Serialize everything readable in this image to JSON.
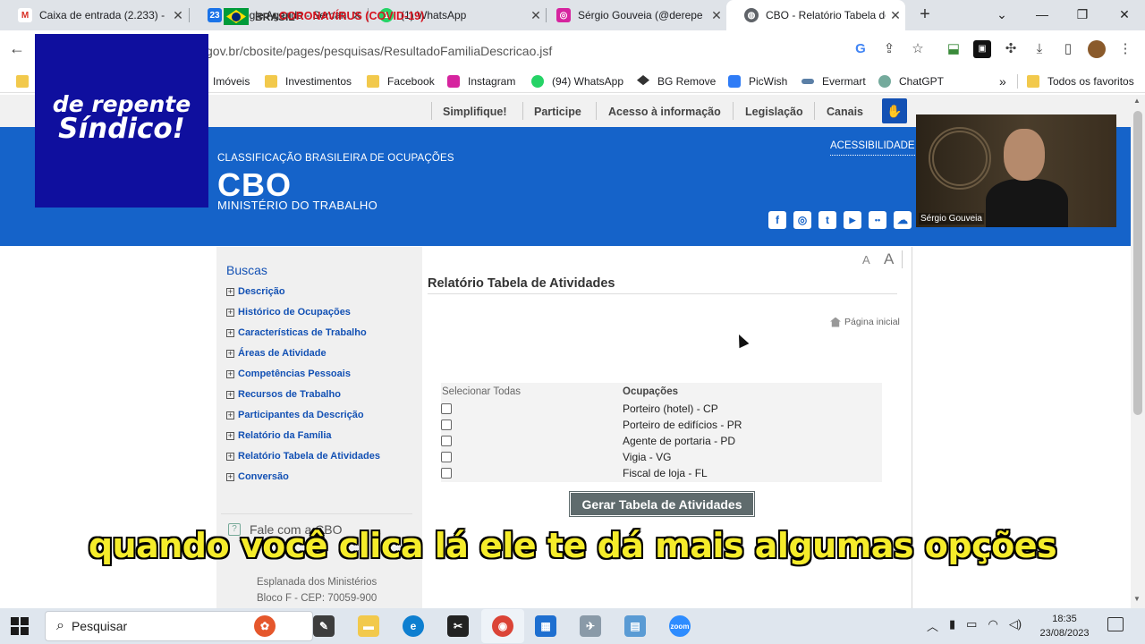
{
  "browser": {
    "tabs": [
      {
        "title": "Caixa de entrada (2.233) -",
        "icon": "gmail-icon",
        "color": "#d93025",
        "glyph": "M"
      },
      {
        "title": "Google Agenda - Semana",
        "icon": "calendar-icon",
        "color": "#1a73e8",
        "glyph": "23"
      },
      {
        "title": "(1) WhatsApp",
        "icon": "whatsapp-icon",
        "color": "#25d366",
        "glyph": "1"
      },
      {
        "title": "Sérgio Gouveia (@derepe",
        "icon": "instagram-icon",
        "color": "#d6249f",
        "glyph": "◎"
      },
      {
        "title": "CBO - Relatório Tabela de",
        "icon": "globe-icon",
        "color": "#5f6368",
        "glyph": "◍"
      }
    ],
    "url": "gov.br/cbosite/pages/pesquisas/ResultadoFamiliaDescricao.jsf",
    "bookmarks": [
      {
        "label": "Imóveis",
        "type": "folder"
      },
      {
        "label": "Investimentos",
        "type": "folder"
      },
      {
        "label": "Facebook",
        "type": "folder"
      },
      {
        "label": "Instagram",
        "type": "site",
        "color": "#d6249f"
      },
      {
        "label": "(94) WhatsApp",
        "type": "site",
        "color": "#25d366"
      },
      {
        "label": "BG Remove",
        "type": "site",
        "color": "#333333"
      },
      {
        "label": "PicWish",
        "type": "site",
        "color": "#2f7cf6"
      },
      {
        "label": "Evermart",
        "type": "site",
        "color": "#5b7fa6"
      },
      {
        "label": "ChatGPT",
        "type": "site",
        "color": "#74aa9c"
      }
    ],
    "more_bookmarks": "»",
    "all_favorites": "Todos os favoritos"
  },
  "overlay_logo": {
    "line1": "de repente",
    "line2": "Síndico!"
  },
  "webcam": {
    "name": "Sérgio Gouveia"
  },
  "govbar": {
    "brasil": "BRASIL",
    "covid": "CORONAVÍRUS (COVID-19)",
    "links": [
      "Simplifique!",
      "Participe",
      "Acesso à informação",
      "Legislação",
      "Canais"
    ]
  },
  "header": {
    "subtitle": "CLASSIFICAÇÃO BRASILEIRA DE OCUPAÇÕES",
    "title": "CBO",
    "ministry": "MINISTÉRIO DO TRABALHO",
    "accessibility": "ACESSIBILIDADE",
    "social": [
      {
        "name": "facebook-icon",
        "glyph": "f"
      },
      {
        "name": "instagram-icon",
        "glyph": "◎"
      },
      {
        "name": "twitter-icon",
        "glyph": "t"
      },
      {
        "name": "youtube-icon",
        "glyph": "▶"
      },
      {
        "name": "flickr-icon",
        "glyph": "••"
      },
      {
        "name": "soundcloud-icon",
        "glyph": "☁"
      }
    ]
  },
  "sidebar": {
    "title": "Buscas",
    "items": [
      "Descrição",
      "Histórico de Ocupações",
      "Características de Trabalho",
      "Áreas de Atividade",
      "Competências Pessoais",
      "Recursos de Trabalho",
      "Participantes da Descrição",
      "Relatório da Família",
      "Relatório Tabela de Atividades",
      "Conversão"
    ],
    "fale": "Fale com a CBO",
    "address1": "Esplanada dos Ministérios",
    "address2": "Bloco F - CEP: 70059-900"
  },
  "main": {
    "font_small": "A",
    "font_large": "A",
    "title": "Relatório Tabela de Atividades",
    "home_link": "Página inicial",
    "select_all": "Selecionar Todas",
    "occupations_header": "Ocupações",
    "occupations": [
      "Porteiro (hotel) - CP",
      "Porteiro de edifícios - PR",
      "Agente de portaria - PD",
      "Vigia - VG",
      "Fiscal de loja - FL"
    ],
    "generate_button": "Gerar Tabela de Atividades"
  },
  "subtitle": "quando você clica lá ele te dá mais algumas opções",
  "taskbar": {
    "search_placeholder": "Pesquisar",
    "time": "18:35",
    "date": "23/08/2023"
  }
}
